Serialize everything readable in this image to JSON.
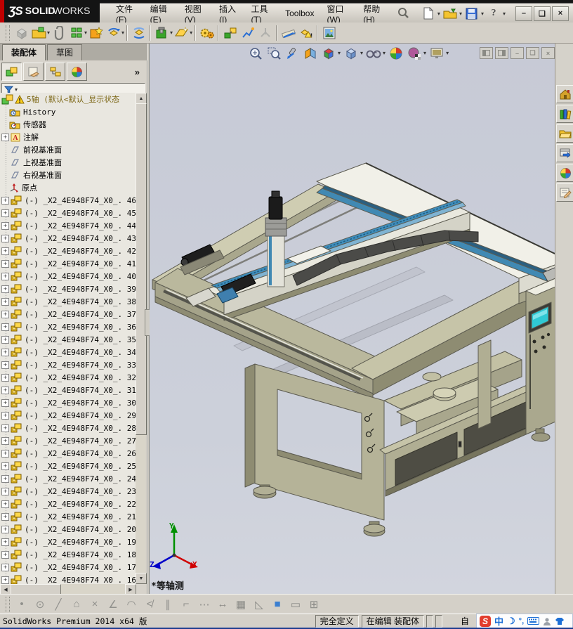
{
  "titlebar": {
    "logo_mark": "ƷS",
    "logo_solid": "SOLID",
    "logo_works": "WORKS",
    "menus": [
      "文件(F)",
      "编辑(E)",
      "视图(V)",
      "插入(I)",
      "工具(T)",
      "Toolbox",
      "窗口(W)",
      "帮助(H)"
    ],
    "quick_access": [
      "new-document",
      "open",
      "save",
      "help"
    ],
    "window_controls": [
      {
        "name": "minimize",
        "glyph": "–"
      },
      {
        "name": "maximize",
        "glyph": "❑"
      },
      {
        "name": "close",
        "glyph": "×"
      }
    ]
  },
  "main_toolbar": {
    "items": [
      "insert-components",
      "insert-part-from-file",
      "mate",
      "linear-component-pattern",
      "smart-fasteners",
      "move-component",
      "show-hidden-components",
      "assembly-features",
      "reference-geometry",
      "new-motion-study",
      "exploded-view",
      "explode-line-sketch",
      "instant-3d",
      "measure",
      "interference-detection",
      "photo-preview"
    ]
  },
  "command_tabs": [
    {
      "label": "装配体",
      "active": true
    },
    {
      "label": "草图",
      "active": false
    }
  ],
  "feature_panel": {
    "pane_icons": [
      "feature-manager",
      "property-manager",
      "configuration-manager",
      "display-manager"
    ],
    "overflow_glyph": "»",
    "root_label": "5轴  (默认<默认_显示状态",
    "items": [
      "History",
      "传感器",
      "注解",
      "前视基准面",
      "上视基准面",
      "右视基准面",
      "原点"
    ],
    "components": {
      "prefix": "(-) _X2_4E948F74_X0_. ",
      "suffix": "<",
      "numbers": [
        "46",
        "45",
        "44",
        "43",
        "42",
        "41",
        "40",
        "39",
        "38",
        "37",
        "36",
        "35",
        "34",
        "33",
        "32",
        "31",
        "30",
        "29",
        "28",
        "27",
        "26",
        "25",
        "24",
        "23",
        "22",
        "21",
        "20",
        "19",
        "18",
        "17",
        "16"
      ]
    }
  },
  "viewport": {
    "hud_icons": [
      "zoom-fit",
      "zoom-area",
      "zoom-previous",
      "section-view",
      "view-orientation",
      "display-style",
      "hide-show-items",
      "edit-appearance",
      "apply-scene",
      "view-settings"
    ],
    "doc_window_controls": [
      {
        "name": "pane-left",
        "glyph": ""
      },
      {
        "name": "pane-right",
        "glyph": ""
      },
      {
        "name": "minimize",
        "glyph": "–"
      },
      {
        "name": "restore",
        "glyph": "❑"
      },
      {
        "name": "close",
        "glyph": "×"
      }
    ],
    "view_label": "*等轴测",
    "triad": {
      "x": "X",
      "y": "Y",
      "z": "Z"
    },
    "colors": {
      "viewport_bg": "#c9ccd7",
      "machine_khaki": "#b5b398",
      "machine_top_white": "#f1f0e8",
      "rail_blue": "#4189b3",
      "screen_teal": "#2fc9d4",
      "axis_x": "#d00000",
      "axis_y": "#009000",
      "axis_z": "#0000c8"
    }
  },
  "task_pane": {
    "icons": [
      "solidworks-resources",
      "design-library",
      "file-explorer",
      "view-palette",
      "appearances-scenes",
      "custom-properties"
    ]
  },
  "sketch_toolbar": {
    "icons": [
      {
        "name": "point",
        "glyph": "•",
        "color": "#90908c"
      },
      {
        "name": "circle",
        "glyph": "⊙",
        "color": "#90908c"
      },
      {
        "name": "line",
        "glyph": "╱",
        "color": "#90908c"
      },
      {
        "name": "polygon",
        "glyph": "⌂",
        "color": "#90908c"
      },
      {
        "name": "trim",
        "glyph": "×",
        "color": "#90908c"
      },
      {
        "name": "sketch-angle",
        "glyph": "∠",
        "color": "#90908c"
      },
      {
        "name": "arc",
        "glyph": "◠",
        "color": "#90908c"
      },
      {
        "name": "chamfer",
        "glyph": "≮",
        "color": "#90908c"
      },
      {
        "name": "parallel",
        "glyph": "∥",
        "color": "#90908c"
      },
      {
        "name": "perpendicular",
        "glyph": "⌐",
        "color": "#90908c"
      },
      {
        "name": "spline",
        "glyph": "⋯",
        "color": "#90908c"
      },
      {
        "name": "dimension",
        "glyph": "↔",
        "color": "#8a8a86"
      },
      {
        "name": "grid",
        "glyph": "▦",
        "color": "#8a8a86"
      },
      {
        "name": "triangle",
        "glyph": "◺",
        "color": "#8a8a86"
      },
      {
        "name": "cube-3d",
        "glyph": "■",
        "color": "#3b7fd0"
      },
      {
        "name": "rectangle",
        "glyph": "▭",
        "color": "#8a8a86"
      },
      {
        "name": "table",
        "glyph": "⊞",
        "color": "#8a8a86"
      }
    ]
  },
  "status_bar": {
    "product": "SolidWorks Premium 2014 x64 版",
    "define_state": "完全定义",
    "edit_state": "在编辑 装配体",
    "custom_hint": "自",
    "ime": {
      "logo": "S",
      "lang": "中",
      "moon": "☽",
      "punct": "°,"
    }
  }
}
